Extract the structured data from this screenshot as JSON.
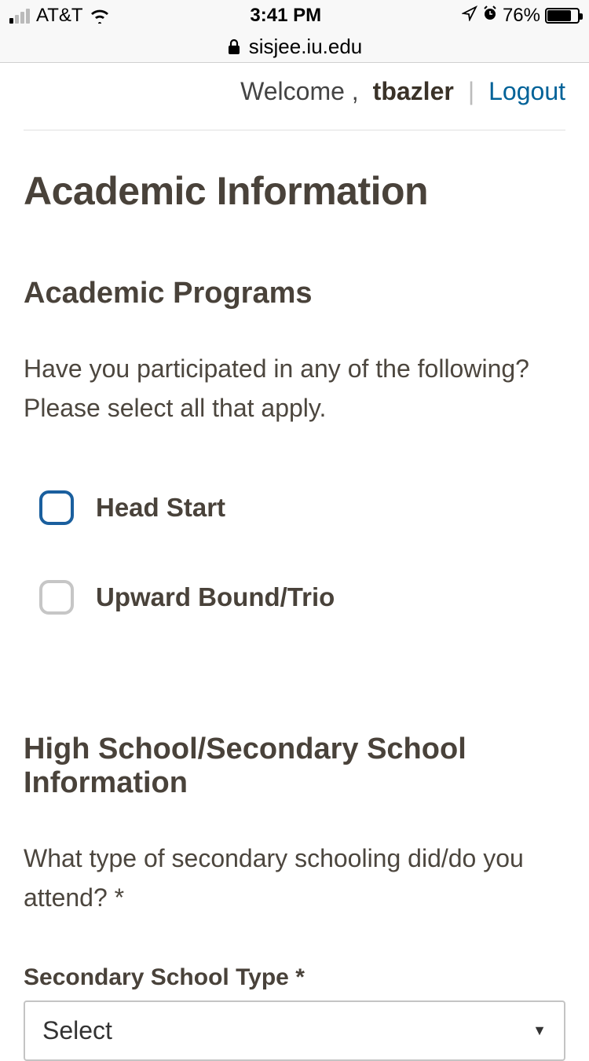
{
  "status": {
    "carrier": "AT&T",
    "time": "3:41 PM",
    "battery_pct": "76%"
  },
  "browser": {
    "url": "sisjee.iu.edu"
  },
  "header": {
    "welcome_text": "Welcome ,",
    "username": "tbazler",
    "divider": "|",
    "logout": "Logout"
  },
  "page": {
    "title": "Academic Information",
    "section_programs": {
      "heading": "Academic Programs",
      "question": "Have you participated in any of the following? Please select all that apply.",
      "options": [
        {
          "label": "Head Start",
          "focused": true
        },
        {
          "label": "Upward Bound/Trio",
          "focused": false
        }
      ]
    },
    "section_highschool": {
      "heading": "High School/Secondary School Information",
      "question": "What type of secondary schooling did/do you attend? *",
      "field_label": "Secondary School Type *",
      "select_value": "Select"
    }
  }
}
